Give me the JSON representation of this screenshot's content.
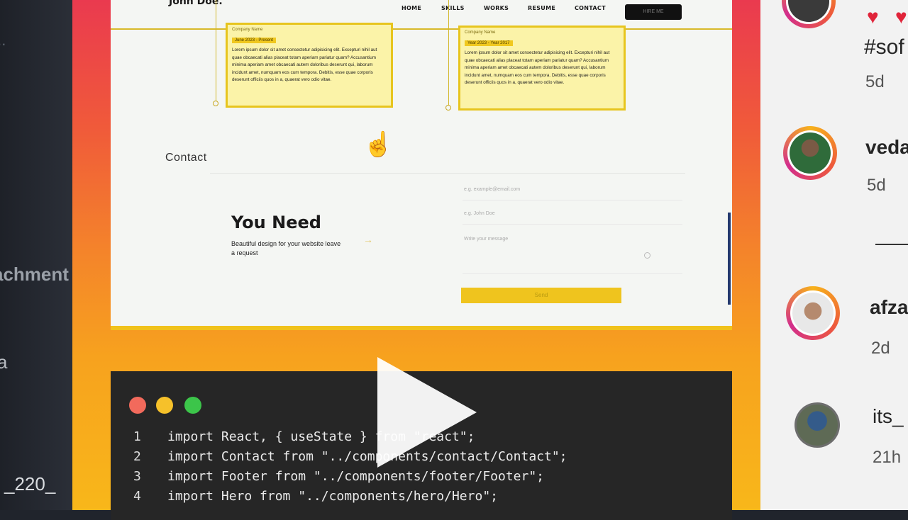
{
  "left_app": {
    "snippets": [
      "...",
      "achment",
      "a",
      "_220_"
    ]
  },
  "site": {
    "logo": "John Doe.",
    "nav": [
      "HOME",
      "SKILLS",
      "WORKS",
      "RESUME",
      "CONTACT"
    ],
    "nav_button": "HIRE ME",
    "cards": [
      {
        "title": "Company Name",
        "date": "June 2023 - Present",
        "text": "Lorem ipsum dolor sit amet consectetur adipisicing elit. Excepturi nihil aut quae obcaecati alias placeat totam aperiam pariatur quam? Accusantium minima aperiam amet obcaecati autem doloribus deserunt qui, laborum incidunt amet, numquam eos cum tempora. Debitis, esse quae corporis deserunt officiis quos in a, quaerat vero odio vitae."
      },
      {
        "title": "Company Name",
        "date": "Year 2023 - Year 2017",
        "text": "Lorem ipsum dolor sit amet consectetur adipisicing elit. Excepturi nihil aut quae obcaecati alias placeat totam aperiam pariatur quam? Accusantium minima aperiam amet obcaecati autem doloribus deserunt qui, laborum incidunt amet, numquam eos cum tempora. Debitis, esse quae corporis deserunt officiis quos in a, quaerat vero odio vitae."
      }
    ],
    "contact_heading": "Contact",
    "need_heading": "You Need",
    "need_sub": "Beautiful design for your website leave a request",
    "arrow": "→",
    "form": {
      "email_placeholder": "e.g. example@email.com",
      "name_placeholder": "e.g. John Doe",
      "message_placeholder": "Write your message",
      "send_label": "Send"
    }
  },
  "code": {
    "lines": [
      {
        "n": "1",
        "text": "import React, { useState } from \"react\";"
      },
      {
        "n": "2",
        "text": "import Contact from \"../components/contact/Contact\";"
      },
      {
        "n": "3",
        "text": "import Footer from \"../components/footer/Footer\";"
      },
      {
        "n": "4",
        "text": "import Hero from \"../components/hero/Hero\";"
      }
    ],
    "dot_colors": [
      "#f26a5c",
      "#f6c12a",
      "#3cc54a"
    ]
  },
  "feed": {
    "hashtag": "#sof",
    "first_age": "5d",
    "users": [
      {
        "name": "veda",
        "age": "5d"
      },
      {
        "name": "afza",
        "age": "2d"
      },
      {
        "name": "its_",
        "age": "21h"
      }
    ]
  }
}
